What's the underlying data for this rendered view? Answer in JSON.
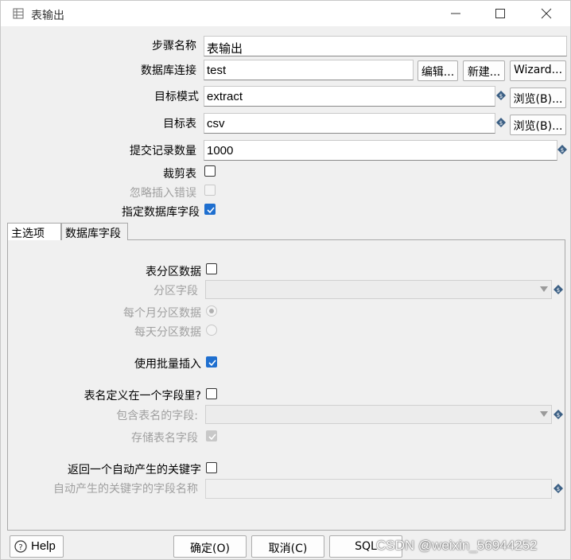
{
  "window": {
    "title": "表输出",
    "icon": "table-icon",
    "controls": [
      "minimize-icon",
      "maximize-icon",
      "close-icon"
    ]
  },
  "form": {
    "step_name": {
      "label": "步骤名称",
      "value": "表输出"
    },
    "connection": {
      "label": "数据库连接",
      "value": "test",
      "edit_button": "编辑...",
      "new_button": "新建...",
      "wizard_button": "Wizard..."
    },
    "target_schema": {
      "label": "目标模式",
      "value": "extract",
      "browse_button": "浏览(B)..."
    },
    "target_table": {
      "label": "目标表",
      "value": "csv",
      "browse_button": "浏览(B)..."
    },
    "commit_size": {
      "label": "提交记录数量",
      "value": "1000"
    },
    "truncate_table": {
      "label": "裁剪表",
      "checked": false
    },
    "ignore_insert_errors": {
      "label": "忽略插入错误",
      "checked": false,
      "enabled": false
    },
    "specify_db_fields": {
      "label": "指定数据库字段",
      "checked": true
    }
  },
  "tabs": [
    {
      "label": "主选项",
      "active": true
    },
    {
      "label": "数据库字段",
      "active": false
    }
  ],
  "main_options": {
    "partition_data": {
      "label": "表分区数据",
      "checked": false
    },
    "partition_field": {
      "label": "分区字段",
      "value": ""
    },
    "partition_monthly": {
      "label": "每个月分区数据",
      "selected": true
    },
    "partition_daily": {
      "label": "每天分区数据",
      "selected": false
    },
    "batch_insert": {
      "label": "使用批量插入",
      "checked": true
    },
    "table_name_in_field": {
      "label": "表名定义在一个字段里?",
      "checked": false
    },
    "table_name_field": {
      "label": "包含表名的字段:",
      "value": ""
    },
    "store_table_name": {
      "label": "存储表名字段",
      "checked": true
    },
    "return_auto_key": {
      "label": "返回一个自动产生的关键字",
      "checked": false
    },
    "auto_key_field_name": {
      "label": "自动产生的关键字的字段名称",
      "value": ""
    }
  },
  "footer": {
    "help_button": "Help",
    "ok_button": "确定(O)",
    "cancel_button": "取消(C)",
    "sql_button": "SQL"
  },
  "watermark": "CSDN @weixin_56944252",
  "colors": {
    "accent": "#1f6fcf",
    "diamond": "#3b5f84"
  }
}
